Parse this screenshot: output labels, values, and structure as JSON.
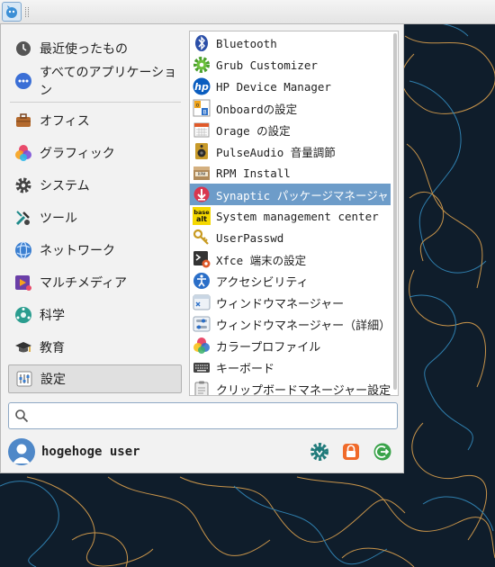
{
  "menu": {
    "categories": [
      {
        "label": "最近使ったもの",
        "icon": "clock-icon"
      },
      {
        "label": "すべてのアプリケーション",
        "icon": "all-apps-icon"
      },
      {
        "label": "オフィス",
        "icon": "briefcase-icon"
      },
      {
        "label": "グラフィック",
        "icon": "graphics-icon"
      },
      {
        "label": "システム",
        "icon": "gear-icon"
      },
      {
        "label": "ツール",
        "icon": "tools-icon"
      },
      {
        "label": "ネットワーク",
        "icon": "network-globe-icon"
      },
      {
        "label": "マルチメディア",
        "icon": "multimedia-icon"
      },
      {
        "label": "科学",
        "icon": "science-icon"
      },
      {
        "label": "教育",
        "icon": "graduation-cap-icon"
      },
      {
        "label": "設定",
        "icon": "settings-sliders-icon",
        "selected": true
      }
    ],
    "apps": [
      {
        "label": "Bluetooth",
        "icon": "bluetooth-icon",
        "mono": true
      },
      {
        "label": "Grub Customizer",
        "icon": "grub-gear-icon",
        "mono": true
      },
      {
        "label": "HP Device Manager",
        "icon": "hp-logo-icon",
        "mono": true
      },
      {
        "label": "Onboardの設定",
        "icon": "onboard-keyboard-icon",
        "mono": true
      },
      {
        "label": "Orage の設定",
        "icon": "calendar-icon",
        "mono": true
      },
      {
        "label": "PulseAudio 音量調節",
        "icon": "speaker-icon",
        "mono": true
      },
      {
        "label": "RPM Install",
        "icon": "rpm-package-icon",
        "mono": true
      },
      {
        "label": "Synaptic パッケージマネージャ",
        "icon": "synaptic-icon",
        "mono": true,
        "highlighted": true
      },
      {
        "label": "System management center",
        "icon": "basealt-icon",
        "mono": true
      },
      {
        "label": "UserPasswd",
        "icon": "keys-icon",
        "mono": true
      },
      {
        "label": "Xfce 端末の設定",
        "icon": "terminal-icon",
        "mono": true
      },
      {
        "label": "アクセシビリティ",
        "icon": "accessibility-icon"
      },
      {
        "label": "ウィンドウマネージャー",
        "icon": "window-manager-icon"
      },
      {
        "label": "ウィンドウマネージャー（詳細）",
        "icon": "window-manager-tweaks-icon"
      },
      {
        "label": "カラープロファイル",
        "icon": "color-profile-icon"
      },
      {
        "label": "キーボード",
        "icon": "keyboard-icon"
      },
      {
        "label": "クリップボードマネージャー設定",
        "icon": "clipboard-icon"
      }
    ],
    "search": {
      "placeholder": "",
      "value": ""
    },
    "user": {
      "name": "hogehoge user"
    },
    "actions": [
      {
        "name": "settings-manager-button",
        "icon": "settings-manager-icon"
      },
      {
        "name": "lock-screen-button",
        "icon": "lock-icon"
      },
      {
        "name": "logout-button",
        "icon": "logout-icon"
      }
    ]
  },
  "colors": {
    "highlight": "#6d9cc9",
    "desktop": "#0f1d2b",
    "lock": "#f06a2a",
    "logout": "#3aa34a"
  }
}
